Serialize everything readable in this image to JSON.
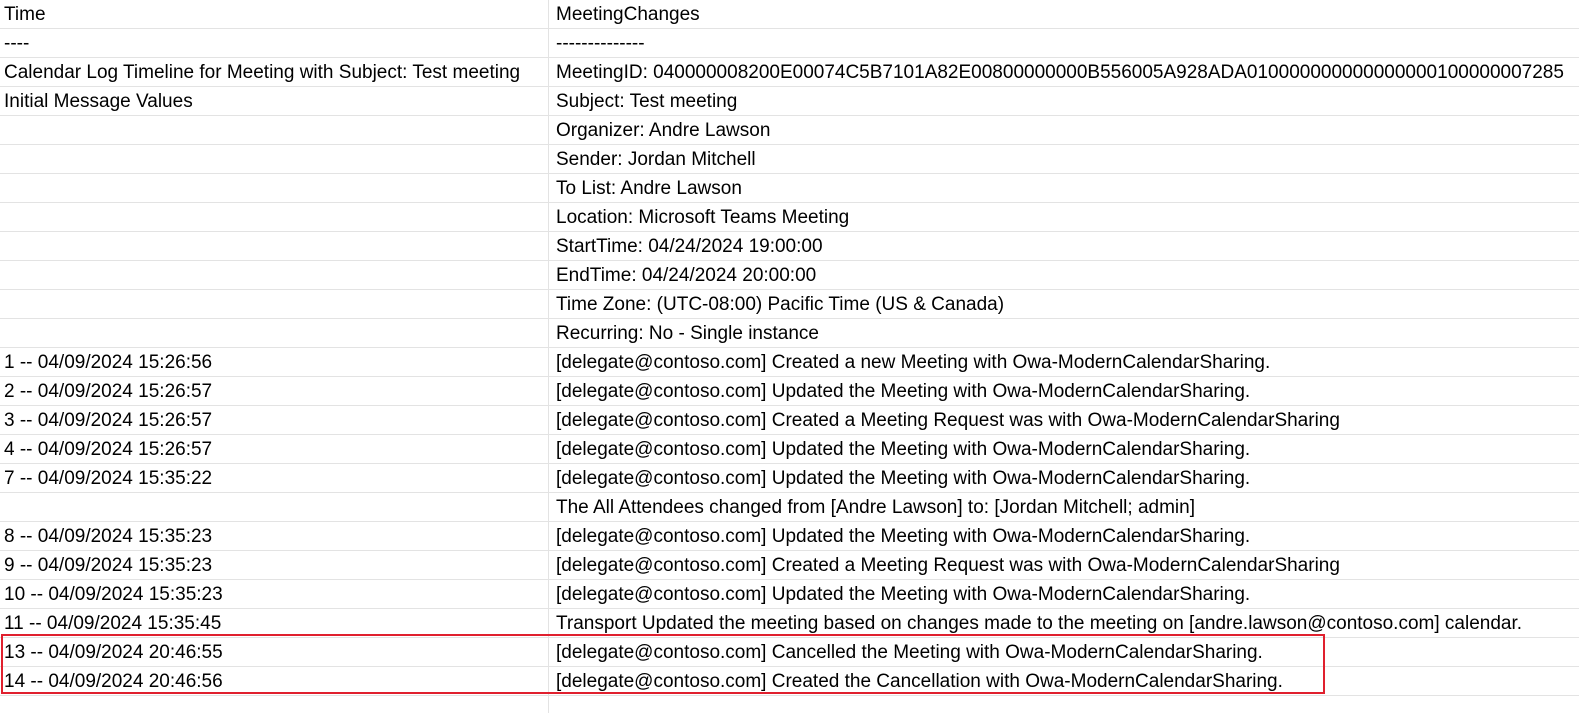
{
  "header": {
    "time": "Time",
    "changes": "MeetingChanges"
  },
  "rows": [
    {
      "time": "----",
      "change": "--------------"
    },
    {
      "time": "Calendar Log Timeline for Meeting with Subject: Test meeting",
      "change": "MeetingID: 040000008200E00074C5B7101A82E00800000000B556005A928ADA010000000000000000100000007285"
    },
    {
      "time": "Initial Message Values",
      "change": "Subject: Test meeting"
    },
    {
      "time": "",
      "change": "Organizer: Andre Lawson"
    },
    {
      "time": "",
      "change": "Sender: Jordan Mitchell"
    },
    {
      "time": "",
      "change": "To List: Andre Lawson"
    },
    {
      "time": "",
      "change": "Location: Microsoft Teams Meeting"
    },
    {
      "time": "",
      "change": "StartTime: 04/24/2024 19:00:00"
    },
    {
      "time": "",
      "change": "EndTime: 04/24/2024 20:00:00"
    },
    {
      "time": "",
      "change": "Time Zone: (UTC-08:00) Pacific Time (US & Canada)"
    },
    {
      "time": "",
      "change": "Recurring: No - Single instance"
    },
    {
      "time": "1  -- 04/09/2024 15:26:56",
      "change": "[delegate@contoso.com] Created a new Meeting with Owa-ModernCalendarSharing."
    },
    {
      "time": "2  -- 04/09/2024 15:26:57",
      "change": "[delegate@contoso.com] Updated the Meeting with Owa-ModernCalendarSharing."
    },
    {
      "time": "3  -- 04/09/2024 15:26:57",
      "change": "[delegate@contoso.com] Created a Meeting Request was with Owa-ModernCalendarSharing"
    },
    {
      "time": "4  -- 04/09/2024 15:26:57",
      "change": "[delegate@contoso.com] Updated the Meeting with Owa-ModernCalendarSharing."
    },
    {
      "time": "7  -- 04/09/2024 15:35:22",
      "change": "[delegate@contoso.com] Updated the Meeting with Owa-ModernCalendarSharing."
    },
    {
      "time": "",
      "change": "The All Attendees changed from [Andre Lawson] to: [Jordan Mitchell; admin]"
    },
    {
      "time": "8  -- 04/09/2024 15:35:23",
      "change": "[delegate@contoso.com] Updated the Meeting with Owa-ModernCalendarSharing."
    },
    {
      "time": "9  -- 04/09/2024 15:35:23",
      "change": "[delegate@contoso.com] Created a Meeting Request was with Owa-ModernCalendarSharing"
    },
    {
      "time": "10  -- 04/09/2024 15:35:23",
      "change": "[delegate@contoso.com] Updated the Meeting with Owa-ModernCalendarSharing."
    },
    {
      "time": "11  -- 04/09/2024 15:35:45",
      "change": "Transport Updated the meeting based on changes made to the meeting on [andre.lawson@contoso.com] calendar."
    },
    {
      "time": "13  -- 04/09/2024 20:46:55",
      "change": "[delegate@contoso.com] Cancelled the Meeting with Owa-ModernCalendarSharing."
    },
    {
      "time": "14  -- 04/09/2024 20:46:56",
      "change": "[delegate@contoso.com] Created the Cancellation with Owa-ModernCalendarSharing."
    },
    {
      "time": "",
      "change": ""
    }
  ],
  "highlight_color": "#e0202e"
}
